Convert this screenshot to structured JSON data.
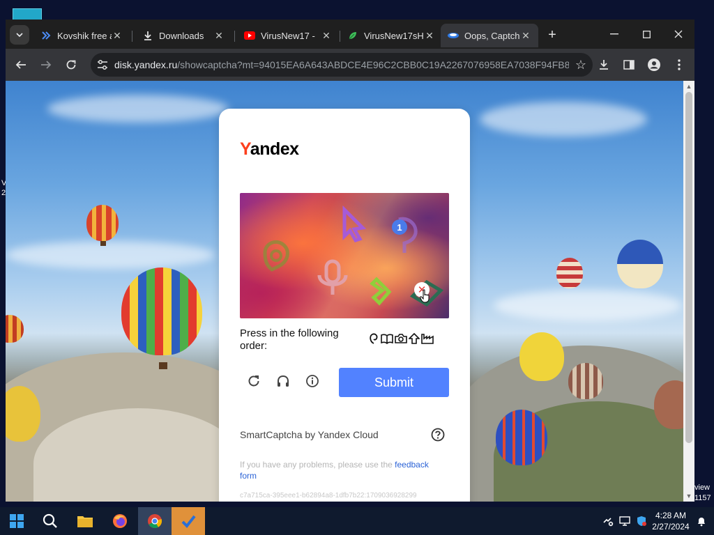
{
  "desktop": {
    "edge_text_left": "V\n2",
    "edge_text_right_1": "view",
    "edge_text_right_2": "1157"
  },
  "browser": {
    "tabs": [
      {
        "title": "Kovshik free a",
        "icon": "double-chevron-icon",
        "active": false
      },
      {
        "title": "Downloads",
        "icon": "download-icon",
        "active": false
      },
      {
        "title": "VirusNew17 -",
        "icon": "youtube-icon",
        "active": false
      },
      {
        "title": "VirusNew17sH",
        "icon": "leaf-icon",
        "active": false
      },
      {
        "title": "Oops, Captcha",
        "icon": "yandex-disk-icon",
        "active": true
      }
    ],
    "url_host": "disk.yandex.ru",
    "url_path": "/showcaptcha?mt=94015EA6A643ABDCE4E96C2CBB0C19A2267076958EA7038F94FB8...",
    "accent": "#35363a"
  },
  "captcha": {
    "logo_first": "Y",
    "logo_rest": "andex",
    "badge_number": "1",
    "instruction": "Press in the following order:",
    "order_icons": [
      "map-pin-icon",
      "book-icon",
      "camera-icon",
      "upload-arrow-icon",
      "factory-icon"
    ],
    "submit_label": "Submit",
    "smart_label": "SmartCaptcha by Yandex Cloud",
    "problems_text": "If you have any problems, please use the ",
    "problems_link": "feedback form",
    "request_id": "c7a715ca-395eee1-b62894a8-1dfb7b22:1709036928299",
    "submit_color": "#5282ff",
    "logo_accent": "#fc3f1d"
  },
  "taskbar": {
    "time": "4:28 AM",
    "date": "2/27/2024"
  }
}
